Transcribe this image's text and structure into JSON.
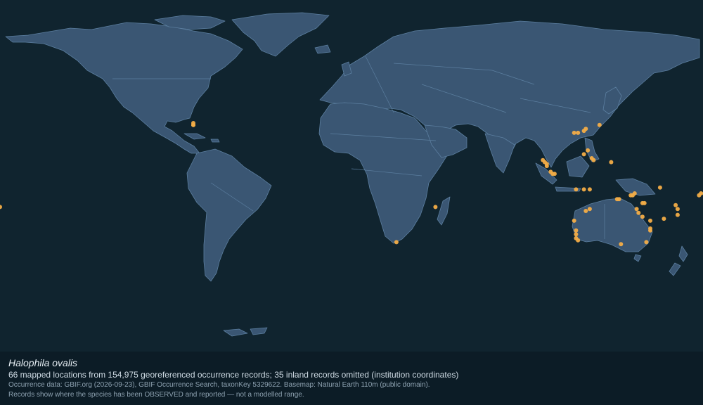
{
  "map": {
    "basemap_colors": {
      "ocean": "#10242f",
      "land": "#3a5673",
      "border": "#5c7fa0",
      "point": "#f3ad47"
    },
    "occurrences": [
      {
        "lon": 179,
        "lat": -9
      },
      {
        "lon": 178,
        "lat": -10
      },
      {
        "lon": -180,
        "lat": -16
      },
      {
        "lon": -81,
        "lat": 26
      },
      {
        "lon": -81,
        "lat": 27
      },
      {
        "lon": -81,
        "lat": 26
      },
      {
        "lon": 43,
        "lat": -16
      },
      {
        "lon": 23,
        "lat": -34
      },
      {
        "lon": 114,
        "lat": 22
      },
      {
        "lon": 116,
        "lat": 22
      },
      {
        "lon": 119,
        "lat": 23
      },
      {
        "lon": 120,
        "lat": 24
      },
      {
        "lon": 127,
        "lat": 26
      },
      {
        "lon": 98,
        "lat": 8
      },
      {
        "lon": 99,
        "lat": 7
      },
      {
        "lon": 100,
        "lat": 6
      },
      {
        "lon": 100,
        "lat": 5
      },
      {
        "lon": 102,
        "lat": 2
      },
      {
        "lon": 103,
        "lat": 1
      },
      {
        "lon": 104,
        "lat": 1
      },
      {
        "lon": 119,
        "lat": 11
      },
      {
        "lon": 121,
        "lat": 13
      },
      {
        "lon": 123,
        "lat": 9
      },
      {
        "lon": 124,
        "lat": 8
      },
      {
        "lon": 133,
        "lat": 7
      },
      {
        "lon": 115,
        "lat": -7
      },
      {
        "lon": 119,
        "lat": -7
      },
      {
        "lon": 122,
        "lat": -7
      },
      {
        "lon": 143,
        "lat": -10
      },
      {
        "lon": 144,
        "lat": -10
      },
      {
        "lon": 145,
        "lat": -9
      },
      {
        "lon": 149,
        "lat": -14
      },
      {
        "lon": 150,
        "lat": -14
      },
      {
        "lon": 158,
        "lat": -6
      },
      {
        "lon": 166,
        "lat": -15
      },
      {
        "lon": 167,
        "lat": -17
      },
      {
        "lon": 167,
        "lat": -20
      },
      {
        "lon": 160,
        "lat": -22
      },
      {
        "lon": 122,
        "lat": -17
      },
      {
        "lon": 120,
        "lat": -18
      },
      {
        "lon": 136,
        "lat": -12
      },
      {
        "lon": 137,
        "lat": -12
      },
      {
        "lon": 146,
        "lat": -17
      },
      {
        "lon": 147,
        "lat": -19
      },
      {
        "lon": 149,
        "lat": -21
      },
      {
        "lon": 153,
        "lat": -23
      },
      {
        "lon": 153,
        "lat": -27
      },
      {
        "lon": 153,
        "lat": -28
      },
      {
        "lon": 114,
        "lat": -23
      },
      {
        "lon": 115,
        "lat": -28
      },
      {
        "lon": 115,
        "lat": -30
      },
      {
        "lon": 115,
        "lat": -32
      },
      {
        "lon": 116,
        "lat": -33
      },
      {
        "lon": 138,
        "lat": -35
      },
      {
        "lon": 151,
        "lat": -34
      }
    ]
  },
  "caption": {
    "species": "Halophila ovalis",
    "summary": "66 mapped locations from 154,975 georeferenced occurrence records; 35 inland records omitted (institution coordinates)",
    "source": "Occurrence data: GBIF.org (2026-09-23), GBIF Occurrence Search, taxonKey 5329622. Basemap: Natural Earth 110m (public domain).",
    "disclaimer": "Records show where the species has been OBSERVED and reported — not a modelled range."
  }
}
